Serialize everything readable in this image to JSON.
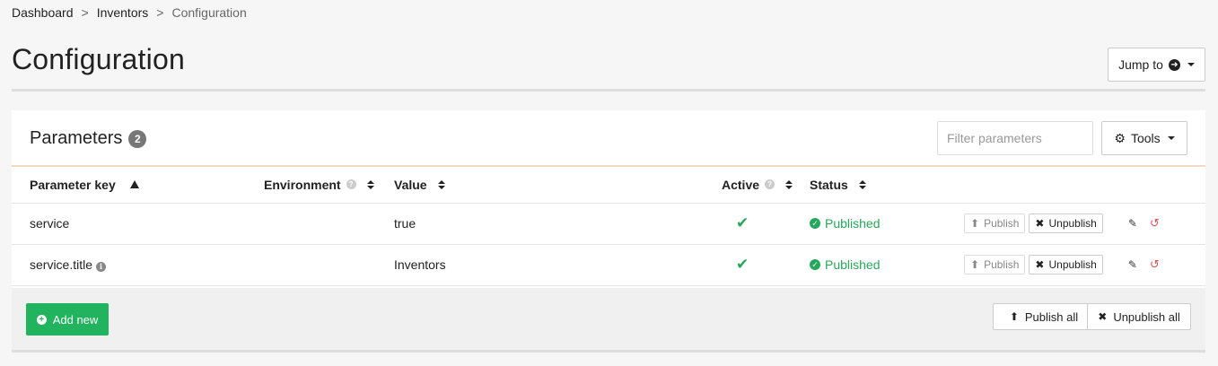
{
  "breadcrumb": {
    "items": [
      "Dashboard",
      "Inventors",
      "Configuration"
    ],
    "separator": ">"
  },
  "page": {
    "title": "Configuration",
    "jump_label": "Jump to"
  },
  "panel": {
    "title": "Parameters",
    "count": "2",
    "filter_placeholder": "Filter parameters",
    "tools_label": "Tools"
  },
  "table": {
    "columns": [
      "Parameter key",
      "Environment",
      "Value",
      "Active",
      "Status"
    ],
    "rows": [
      {
        "key": "service",
        "environment": "",
        "value": "true",
        "active": true,
        "status": "Published",
        "publish_label": "Publish",
        "unpublish_label": "Unpublish"
      },
      {
        "key": "service.title",
        "environment": "",
        "value": "Inventors",
        "active": true,
        "status": "Published",
        "publish_label": "Publish",
        "unpublish_label": "Unpublish"
      }
    ]
  },
  "footer": {
    "add_label": "Add new",
    "publish_all_label": "Publish all",
    "unpublish_all_label": "Unpublish all"
  },
  "colors": {
    "success": "#26a85a",
    "add_button": "#22b35e",
    "danger": "#e05555",
    "header_rule": "#f5d9c4"
  },
  "icons": {
    "jump": "arrow-circle-right-icon",
    "tools": "gears-icon",
    "active": "check-icon",
    "status": "check-circle-icon",
    "info": "info-circle-icon",
    "help": "question-circle-icon",
    "publish": "upload-icon",
    "unpublish": "x-icon",
    "edit": "pencil-icon",
    "revert": "undo-icon",
    "add": "plus-circle-icon"
  }
}
